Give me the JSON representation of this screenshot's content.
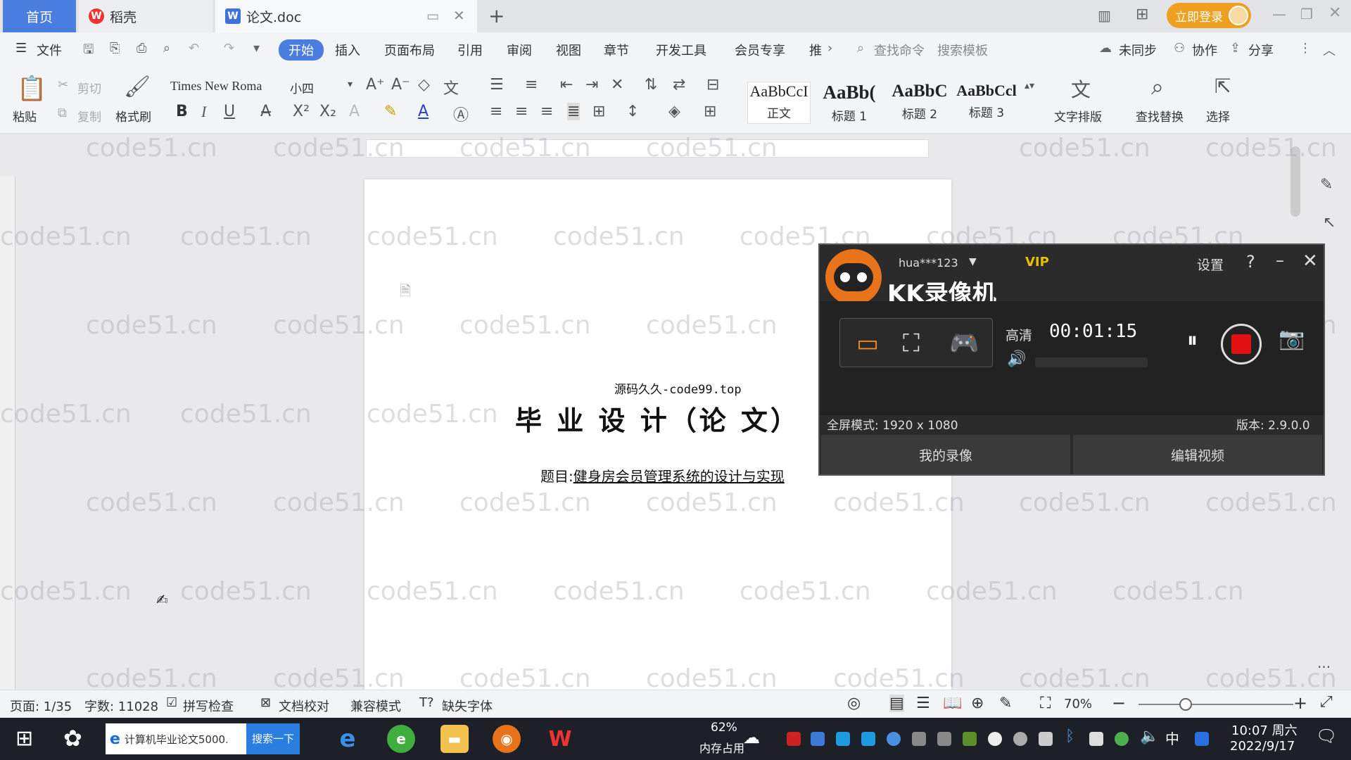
{
  "tabs": {
    "home": "首页",
    "daoke": "稻壳",
    "doc": "论文.doc",
    "login": "立即登录"
  },
  "menu": {
    "file": "文件",
    "start": "开始",
    "insert": "插入",
    "layout": "页面布局",
    "reference": "引用",
    "review": "审阅",
    "view": "视图",
    "chapter": "章节",
    "devtools": "开发工具",
    "member": "会员专享",
    "more": "推",
    "search_cmd": "查找命令",
    "search_tpl": "搜索模板",
    "sync": "未同步",
    "collab": "协作",
    "share": "分享"
  },
  "ribbon": {
    "cut": "剪切",
    "paste": "粘贴",
    "copy": "复制",
    "format_painter": "格式刷",
    "font_name": "Times New Roma",
    "font_size": "小四",
    "styles": [
      {
        "sample": "AaBbCcI",
        "name": "正文"
      },
      {
        "sample": "AaBb(",
        "name": "标题 1"
      },
      {
        "sample": "AaBbC",
        "name": "标题 2"
      },
      {
        "sample": "AaBbCcl",
        "name": "标题 3"
      }
    ],
    "text_layout": "文字排版",
    "find_replace": "查找替换",
    "select": "选择"
  },
  "document": {
    "source": "源码久久-code99.top",
    "title": "毕 业 设 计（论 文）",
    "subject_label": "题目:",
    "subject": "健身房会员管理系统的设计与实现"
  },
  "watermark": "code51.cn",
  "recorder": {
    "user": "hua***123",
    "vip": "VIP",
    "settings": "设置",
    "app_name": "KK录像机",
    "quality": "高清",
    "timer": "00:01:15",
    "mode": "全屏模式: 1920 x 1080",
    "version": "版本: 2.9.0.0",
    "my_recordings": "我的录像",
    "edit_video": "编辑视频"
  },
  "status": {
    "page": "页面: 1/35",
    "words": "字数: 11028",
    "spell": "拼写检查",
    "proof": "文档校对",
    "compat": "兼容模式",
    "missing_font": "缺失字体",
    "zoom": "70%"
  },
  "taskbar": {
    "search_text": "计算机毕业论文5000...",
    "search_btn": "搜索一下",
    "mem_pct": "62%",
    "mem_label": "内存占用",
    "ime": "中",
    "time": "10:07 周六",
    "date": "2022/9/17"
  }
}
